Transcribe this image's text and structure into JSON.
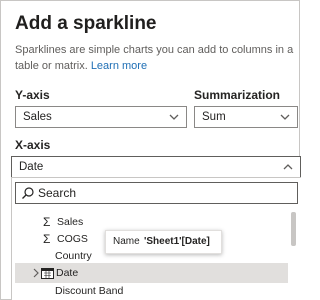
{
  "dialog": {
    "title": "Add a sparkline",
    "description": "Sparklines are simple charts you can add to columns in a table or matrix.",
    "learn_more": "Learn more"
  },
  "y_axis": {
    "label": "Y-axis",
    "value": "Sales"
  },
  "summarization": {
    "label": "Summarization",
    "value": "Sum"
  },
  "x_axis": {
    "label": "X-axis",
    "value": "Date"
  },
  "search": {
    "placeholder": "Search"
  },
  "fields": [
    {
      "label": "Sales",
      "icon": "sigma-icon"
    },
    {
      "label": "COGS",
      "icon": "sigma-icon"
    },
    {
      "label": "Country"
    },
    {
      "label": "Date",
      "icon": "calendar-icon",
      "expandable": true
    },
    {
      "label": "Discount Band"
    }
  ],
  "tooltip": {
    "name_key": "Name",
    "name_value": "'Sheet1'[Date]"
  },
  "colors": {
    "link": "#1f6fb5",
    "selected_row": "#e1dfdd",
    "border": "#8a8886"
  }
}
